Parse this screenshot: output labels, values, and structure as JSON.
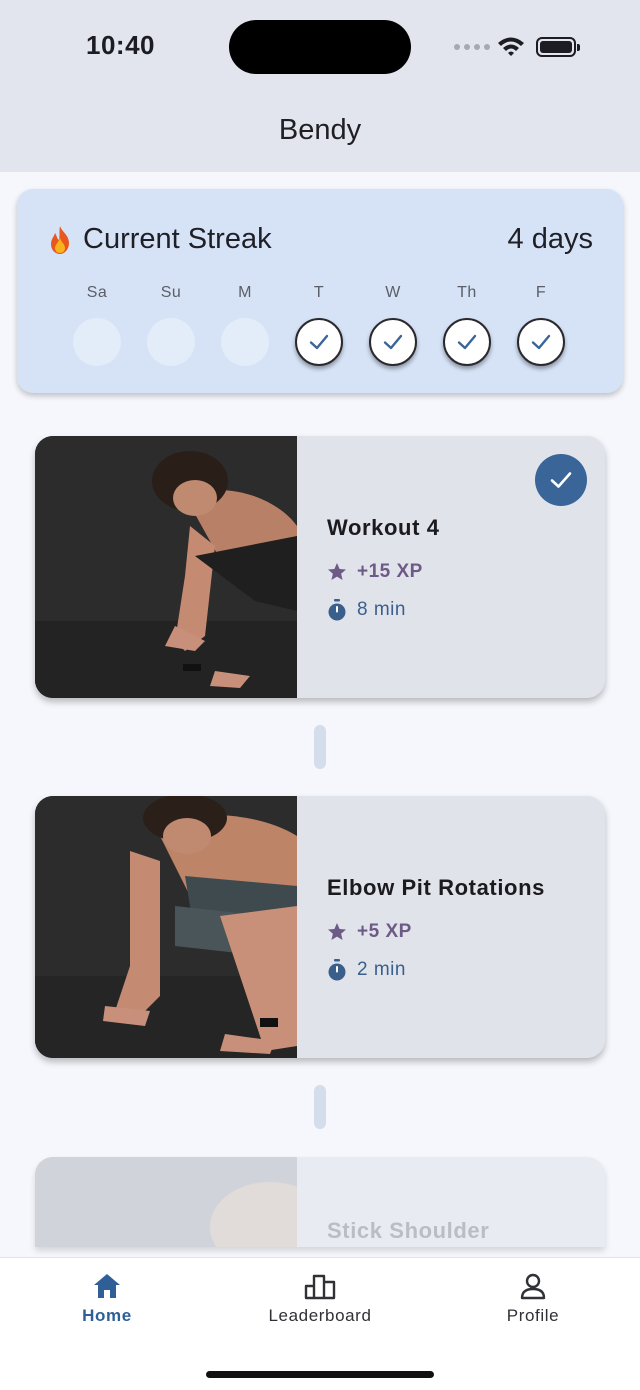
{
  "status_bar": {
    "time": "10:40"
  },
  "header": {
    "title": "Bendy"
  },
  "streak": {
    "title": "Current Streak",
    "value": "4 days",
    "days": [
      {
        "label": "Sa",
        "done": false
      },
      {
        "label": "Su",
        "done": false
      },
      {
        "label": "M",
        "done": false
      },
      {
        "label": "T",
        "done": true
      },
      {
        "label": "W",
        "done": true
      },
      {
        "label": "Th",
        "done": true
      },
      {
        "label": "F",
        "done": true
      }
    ]
  },
  "workouts": [
    {
      "title": "Workout 4",
      "xp": "+15 XP",
      "duration": "8 min",
      "completed": true
    },
    {
      "title": "Elbow Pit Rotations",
      "xp": "+5 XP",
      "duration": "2 min",
      "completed": false
    },
    {
      "title": "Stick Shoulder",
      "xp": "",
      "duration": "",
      "completed": false,
      "locked": true
    }
  ],
  "tabs": [
    {
      "label": "Home",
      "icon": "home-icon",
      "active": true
    },
    {
      "label": "Leaderboard",
      "icon": "leaderboard-icon",
      "active": false
    },
    {
      "label": "Profile",
      "icon": "person-icon",
      "active": false
    }
  ],
  "colors": {
    "accent": "#3a6598",
    "xp": "#6e5a87",
    "streak_card": "#d6e3f7",
    "card": "#e1e3eb"
  }
}
